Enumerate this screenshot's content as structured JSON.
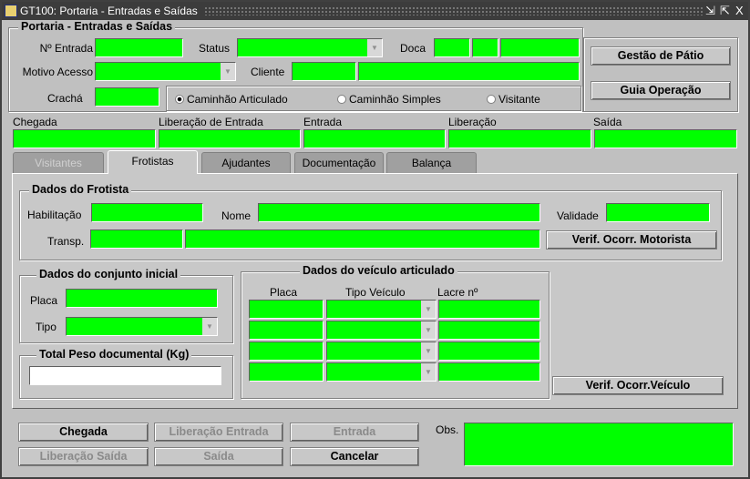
{
  "window": {
    "title": "GT100: Portaria - Entradas e Saídas",
    "minimize": "⇲",
    "maximize": "⇱",
    "close": "X"
  },
  "header": {
    "group_title": "Portaria - Entradas e Saídas",
    "labels": {
      "entry_no": "Nº Entrada",
      "status": "Status",
      "dock": "Doca",
      "access_reason": "Motivo Acesso",
      "client": "Cliente",
      "badge": "Crachá"
    },
    "radios": [
      {
        "label": "Caminhão Articulado",
        "checked": true
      },
      {
        "label": "Caminhão Simples",
        "checked": false
      },
      {
        "label": "Visitante",
        "checked": false
      }
    ],
    "buttons": {
      "yard": "Gestão de Pátio",
      "guide": "Guia Operação"
    }
  },
  "times": {
    "labels": [
      "Chegada",
      "Liberação de Entrada",
      "Entrada",
      "Liberação",
      "Saída"
    ]
  },
  "tabs": [
    {
      "label": "Visitantes",
      "state": "disabled"
    },
    {
      "label": "Frotistas",
      "state": "active"
    },
    {
      "label": "Ajudantes",
      "state": "normal"
    },
    {
      "label": "Documentação",
      "state": "normal"
    },
    {
      "label": "Balança",
      "state": "normal"
    }
  ],
  "driver": {
    "title": "Dados do Frotista",
    "license": "Habilitação",
    "name": "Nome",
    "validity": "Validade",
    "carrier": "Transp.",
    "check_button": "Verif. Ocorr. Motorista"
  },
  "initial_set": {
    "title": "Dados do conjunto inicial",
    "plate": "Placa",
    "type": "Tipo"
  },
  "weight": {
    "title": "Total Peso documental (Kg)",
    "value": ""
  },
  "vehicle": {
    "title": "Dados do veículo articulado",
    "columns": [
      "Placa",
      "Tipo Veículo",
      "Lacre nº"
    ],
    "check_button": "Verif. Ocorr.Veículo"
  },
  "actions": {
    "arrival": "Chegada",
    "entry_release": "Liberação Entrada",
    "entry": "Entrada",
    "exit_release": "Liberação Saída",
    "exit": "Saída",
    "cancel": "Cancelar"
  },
  "obs": {
    "label": "Obs."
  },
  "colors": {
    "field": "#00ff00",
    "bg": "#c0c0c0"
  }
}
